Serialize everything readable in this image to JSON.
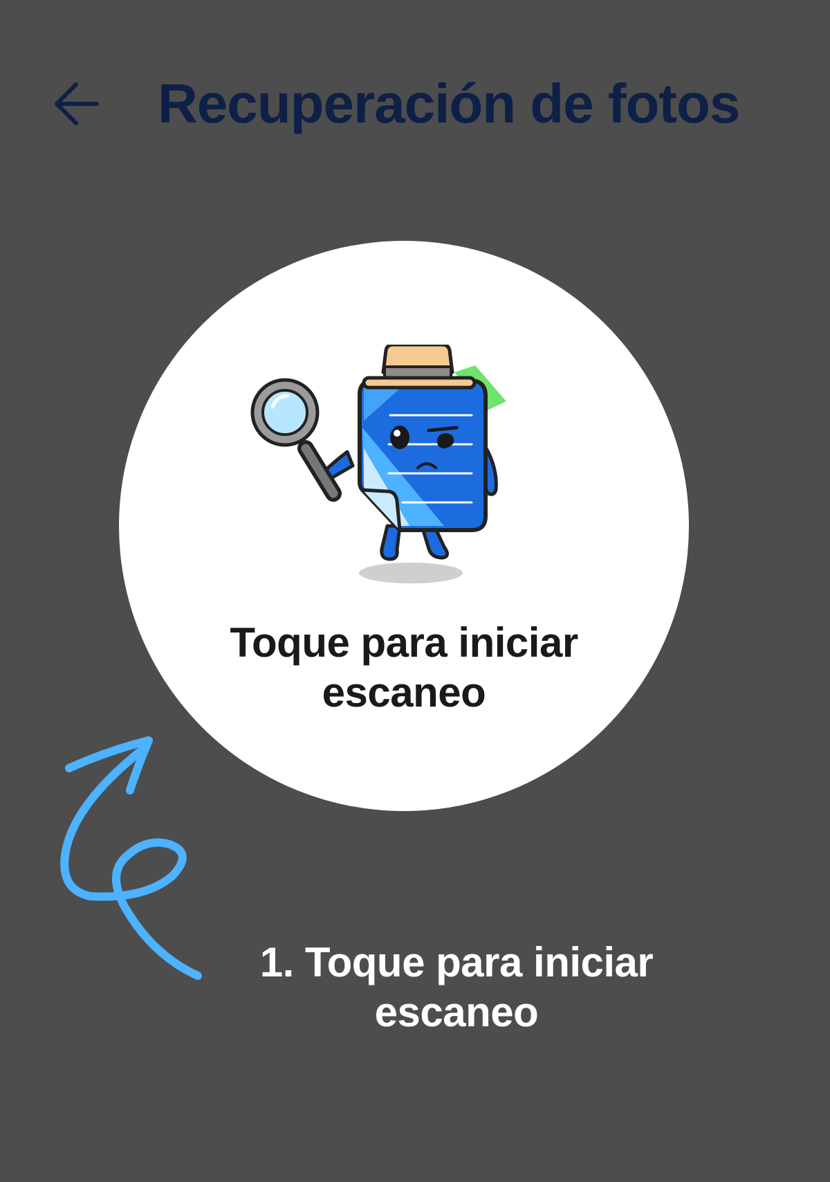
{
  "header": {
    "back_icon": "arrow-left-icon",
    "title": "Recuperación de fotos"
  },
  "scan_button": {
    "illustration": "detective-note-mascot",
    "label_line1": "Toque para iniciar",
    "label_line2": "escaneo"
  },
  "instruction": {
    "arrow_icon": "curly-arrow-icon",
    "line1": "1. Toque para iniciar",
    "line2": "escaneo"
  },
  "colors": {
    "background": "#4d4d4d",
    "title": "#0e2046",
    "circle": "#ffffff",
    "accent_arrow": "#4db2ff",
    "mascot_blue": "#1c6ce0"
  }
}
